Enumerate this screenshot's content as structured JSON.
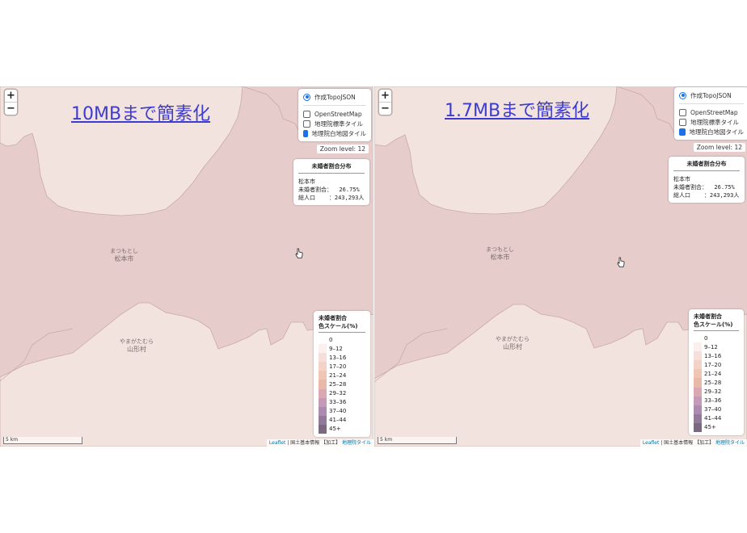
{
  "panels": [
    {
      "id": "left",
      "title": "10MBまで簡素化",
      "zoom": {
        "in_label": "+",
        "out_label": "−"
      },
      "layers": {
        "base": "作成TopoJSON",
        "overlays": [
          {
            "label": "OpenStreetMap",
            "checked": false
          },
          {
            "label": "地理院標準タイル",
            "checked": false
          },
          {
            "label": "地理院白地図タイル",
            "checked": true
          }
        ]
      },
      "zoom_level": "Zoom level: 12",
      "info": {
        "title": "未婚者割合分布",
        "city": "松本市",
        "rate": "未婚者割合：  26.75%",
        "population": "総人口    ：243,293人"
      },
      "places": [
        {
          "kana": "まつもとし",
          "name": "松本市"
        },
        {
          "kana": "やまがたむら",
          "name": "山形村"
        }
      ],
      "scale": "5 km",
      "attribution": {
        "leaflet": "Leaflet",
        "text": " | 国土基本情報 【加工】 ",
        "tile": "地理院タイル"
      }
    },
    {
      "id": "right",
      "title": "1.7MBまで簡素化",
      "zoom": {
        "in_label": "+",
        "out_label": "−"
      },
      "layers": {
        "base": "作成TopoJSON",
        "overlays": [
          {
            "label": "OpenStreetMap",
            "checked": false
          },
          {
            "label": "地理院標準タイル",
            "checked": false
          },
          {
            "label": "地理院白地図タイル",
            "checked": true
          }
        ]
      },
      "zoom_level": "Zoom level: 12",
      "info": {
        "title": "未婚者割合分布",
        "city": "松本市",
        "rate": "未婚者割合：  26.75%",
        "population": "総人口    ：243,293人"
      },
      "places": [
        {
          "kana": "まつもとし",
          "name": "松本市"
        },
        {
          "kana": "やまがたむら",
          "name": "山形村"
        }
      ],
      "scale": "5 km",
      "attribution": {
        "leaflet": "Leaflet",
        "text": " | 国土基本情報 【加工】 ",
        "tile": "地理院タイル"
      }
    }
  ],
  "legend": {
    "title_line1": "未婚者割合",
    "title_line2": "色スケール(%)",
    "items": [
      {
        "label": "0",
        "color": "#ffffff"
      },
      {
        "label": "9–12",
        "color": "#fbf0ee"
      },
      {
        "label": "13–16",
        "color": "#f6dfdb"
      },
      {
        "label": "17–20",
        "color": "#f3d2c8"
      },
      {
        "label": "21–24",
        "color": "#efc6b4"
      },
      {
        "label": "25–28",
        "color": "#e8b8a8"
      },
      {
        "label": "29–32",
        "color": "#d9a8b2"
      },
      {
        "label": "33–36",
        "color": "#c59ab8"
      },
      {
        "label": "37–40",
        "color": "#ad8bb0"
      },
      {
        "label": "41–44",
        "color": "#927a9a"
      },
      {
        "label": "45+",
        "color": "#7a6a7f"
      }
    ]
  },
  "colors": {
    "matsumoto_fill": "#e6cdcc",
    "neighbor_fill": "#f2e3de",
    "title_link": "#3d3ccf"
  }
}
